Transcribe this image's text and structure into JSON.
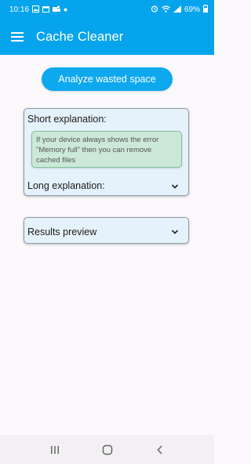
{
  "status_bar": {
    "time": "10:16",
    "battery": "69%"
  },
  "app_bar": {
    "title": "Cache Cleaner"
  },
  "analyze_button": {
    "label": "Analyze wasted space"
  },
  "explanation_card": {
    "short_heading": "Short explanation:",
    "short_text": "If your device always shows the error \"Memory full\" then you can remove cached files",
    "long_heading": "Long explanation:"
  },
  "results_card": {
    "heading": "Results preview"
  },
  "colors": {
    "primary": "#05a4ec",
    "card_bg": "#e5f1fb",
    "note_bg": "#cce8d8"
  },
  "icons": {
    "menu": "hamburger-menu-icon",
    "expand": "chevron-down-icon",
    "nav_recents": "recents-icon",
    "nav_home": "home-icon",
    "nav_back": "back-icon"
  }
}
